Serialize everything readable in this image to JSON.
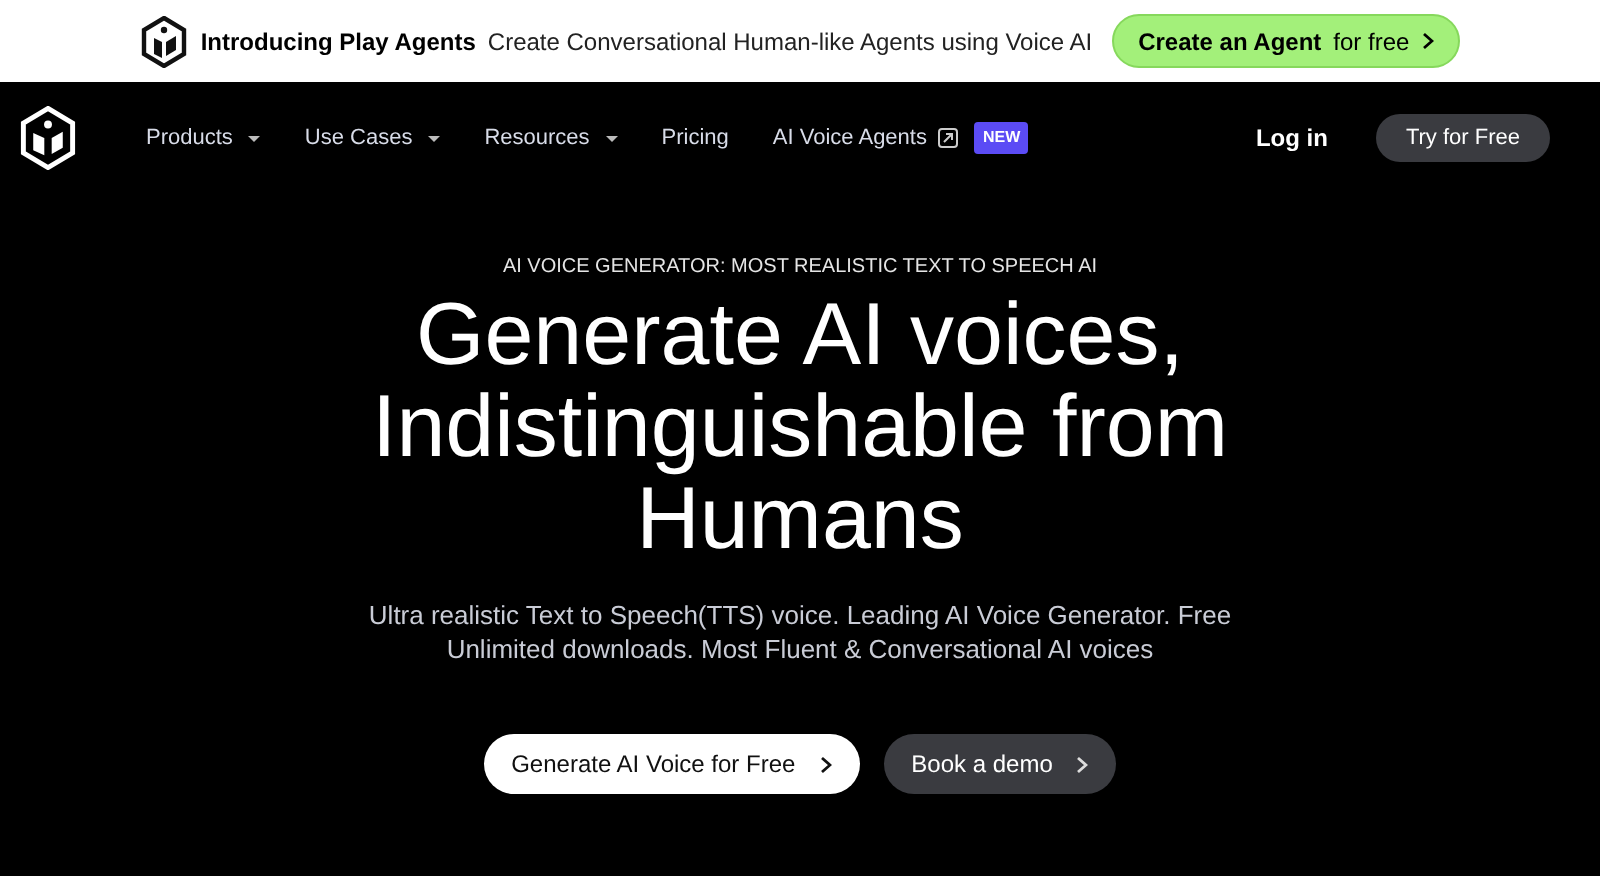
{
  "announcement": {
    "title": "Introducing Play Agents",
    "text": "Create Conversational Human-like Agents using Voice AI",
    "button": {
      "label": "Create an Agent",
      "suffix": "for free"
    }
  },
  "nav": {
    "items": [
      {
        "label": "Products",
        "kind": "dropdown"
      },
      {
        "label": "Use Cases",
        "kind": "dropdown"
      },
      {
        "label": "Resources",
        "kind": "dropdown"
      },
      {
        "label": "Pricing",
        "kind": "link"
      },
      {
        "label": "AI Voice Agents",
        "kind": "external",
        "badge": "NEW"
      }
    ],
    "login": "Log in",
    "cta": "Try for Free"
  },
  "hero": {
    "eyebrow": "AI VOICE GENERATOR: MOST REALISTIC TEXT TO SPEECH AI",
    "headline": [
      "Generate AI voices,",
      "Indistinguishable from",
      "Humans"
    ],
    "subtitle": [
      "Ultra realistic Text to Speech(TTS) voice. Leading AI Voice Generator. Free",
      "Unlimited downloads. Most Fluent & Conversational AI voices"
    ],
    "buttons": [
      {
        "label": "Generate AI Voice for Free",
        "kind": "primary"
      },
      {
        "label": "Book a demo",
        "kind": "secondary"
      }
    ]
  }
}
